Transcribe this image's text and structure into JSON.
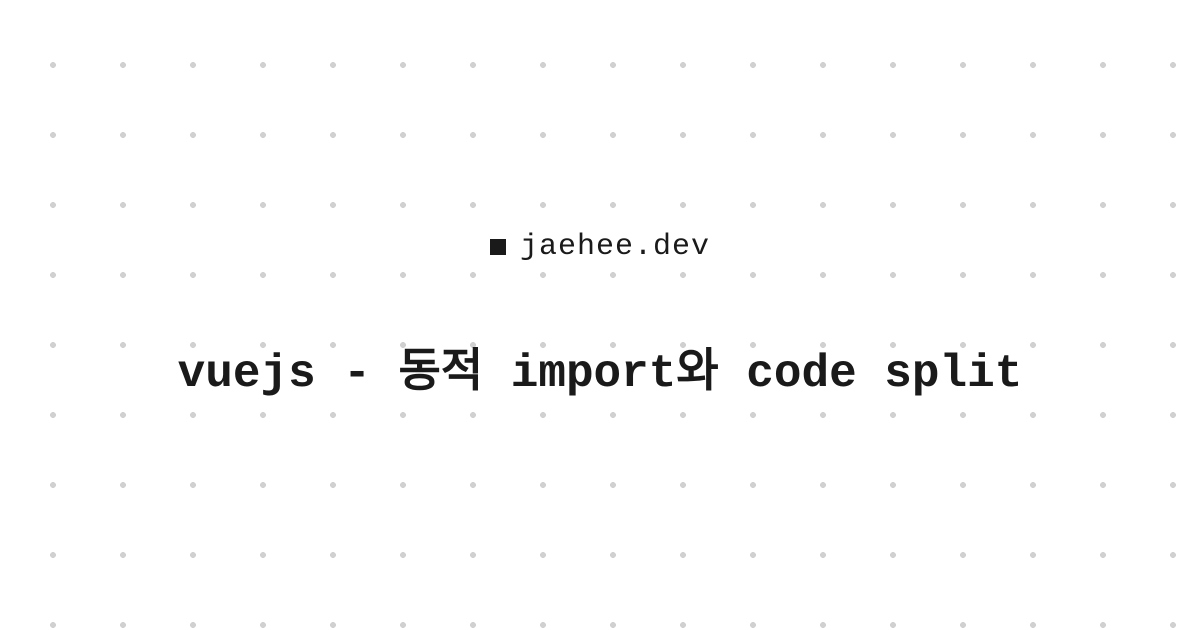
{
  "site": {
    "name": "jaehee.dev"
  },
  "post": {
    "title": "vuejs - 동적 import와 code split"
  }
}
